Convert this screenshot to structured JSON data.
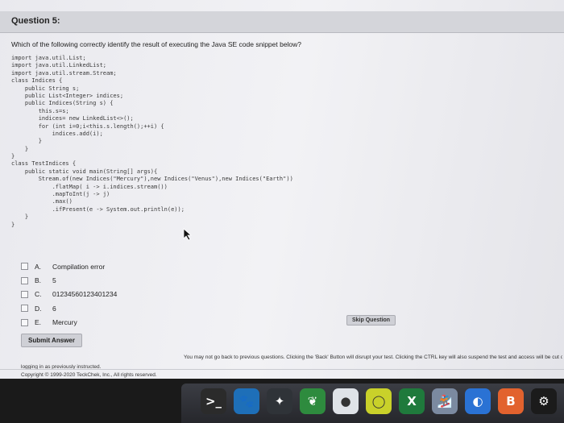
{
  "question": {
    "title": "Question 5:",
    "prompt": "Which of the following correctly identify the result of executing the Java SE code snippet below?",
    "code_lines": [
      "import java.util.List;",
      "import java.util.LinkedList;",
      "import java.util.stream.Stream;",
      "class Indices {",
      "    public String s;",
      "    public List<Integer> indices;",
      "    public Indices(String s) {",
      "        this.s=s;",
      "        indices= new LinkedList<>();",
      "        for (int i=0;i<this.s.length();++i) {",
      "            indices.add(i);",
      "        }",
      "    }",
      "}",
      "class TestIndices {",
      "    public static void main(String[] args){",
      "        Stream.of(new Indices(\"Mercury\"),new Indices(\"Venus\"),new Indices(\"Earth\"))",
      "            .flatMap( i -> i.indices.stream())",
      "            .mapToInt(j -> j)",
      "            .max()",
      "            .ifPresent(e -> System.out.println(e));",
      "    }",
      "}"
    ],
    "options": [
      {
        "letter": "A.",
        "text": "Compilation error"
      },
      {
        "letter": "B.",
        "text": "5"
      },
      {
        "letter": "C.",
        "text": "01234560123401234"
      },
      {
        "letter": "D.",
        "text": "6"
      },
      {
        "letter": "E.",
        "text": "Mercury"
      }
    ]
  },
  "actions": {
    "skip_label": "Skip Question",
    "submit_label": "Submit Answer"
  },
  "notice": {
    "line1": "You may not go back to previous questions. Clicking the 'Back' Button will disrupt your test. Clicking the CTRL key will also suspend the test and access will be cut off. In case of a network failure",
    "line2": "logging in as previously instructed."
  },
  "footer": {
    "copyright": "Copyright © 1999-2020 TeckChek, Inc., All rights reserved."
  },
  "dock": {
    "icons": [
      {
        "name": "terminal-icon",
        "glyph": ">_",
        "bg": "#2b2b2b"
      },
      {
        "name": "paw-icon",
        "glyph": "🐾",
        "bg": "#1e6fb8"
      },
      {
        "name": "butterfly-icon",
        "glyph": "✦",
        "bg": "#2f3338"
      },
      {
        "name": "leaf-icon",
        "glyph": "❦",
        "bg": "#2e8b3e"
      },
      {
        "name": "chrome-icon",
        "glyph": "●",
        "bg": "#dfe3e8"
      },
      {
        "name": "record-icon",
        "glyph": "◯",
        "bg": "#c9d12a"
      },
      {
        "name": "excel-icon",
        "glyph": "X",
        "bg": "#1f7a3c"
      },
      {
        "name": "figure-icon",
        "glyph": "🏂",
        "bg": "#7b8aa0"
      },
      {
        "name": "blue-circle-icon",
        "glyph": "◐",
        "bg": "#2a72d4"
      },
      {
        "name": "b-icon",
        "glyph": "B",
        "bg": "#e2622e"
      },
      {
        "name": "gear-icon",
        "glyph": "⚙",
        "bg": "#1b1b1b"
      }
    ]
  }
}
